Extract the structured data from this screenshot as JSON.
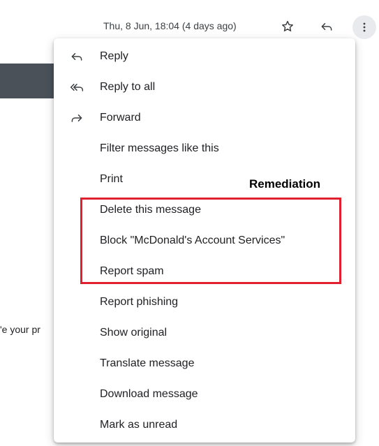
{
  "header": {
    "date": "Thu, 8 Jun, 18:04 (4 days ago)",
    "icons": [
      "star-icon",
      "reply-icon",
      "more-vert-icon"
    ]
  },
  "background": {
    "fragment_text": "'e your pr"
  },
  "menu": {
    "items": [
      {
        "label": "Reply",
        "icon": "reply-icon"
      },
      {
        "label": "Reply to all",
        "icon": "reply-all-icon"
      },
      {
        "label": "Forward",
        "icon": "forward-icon"
      },
      {
        "label": "Filter messages like this",
        "icon": ""
      },
      {
        "label": "Print",
        "icon": ""
      },
      {
        "label": "Delete this message",
        "icon": ""
      },
      {
        "label": "Block \"McDonald's Account Services\"",
        "icon": ""
      },
      {
        "label": "Report spam",
        "icon": ""
      },
      {
        "label": "Report phishing",
        "icon": ""
      },
      {
        "label": "Show original",
        "icon": ""
      },
      {
        "label": "Translate message",
        "icon": ""
      },
      {
        "label": "Download message",
        "icon": ""
      },
      {
        "label": "Mark as unread",
        "icon": ""
      }
    ]
  },
  "annotation": {
    "label": "Remediation",
    "color": "#e0202e"
  }
}
